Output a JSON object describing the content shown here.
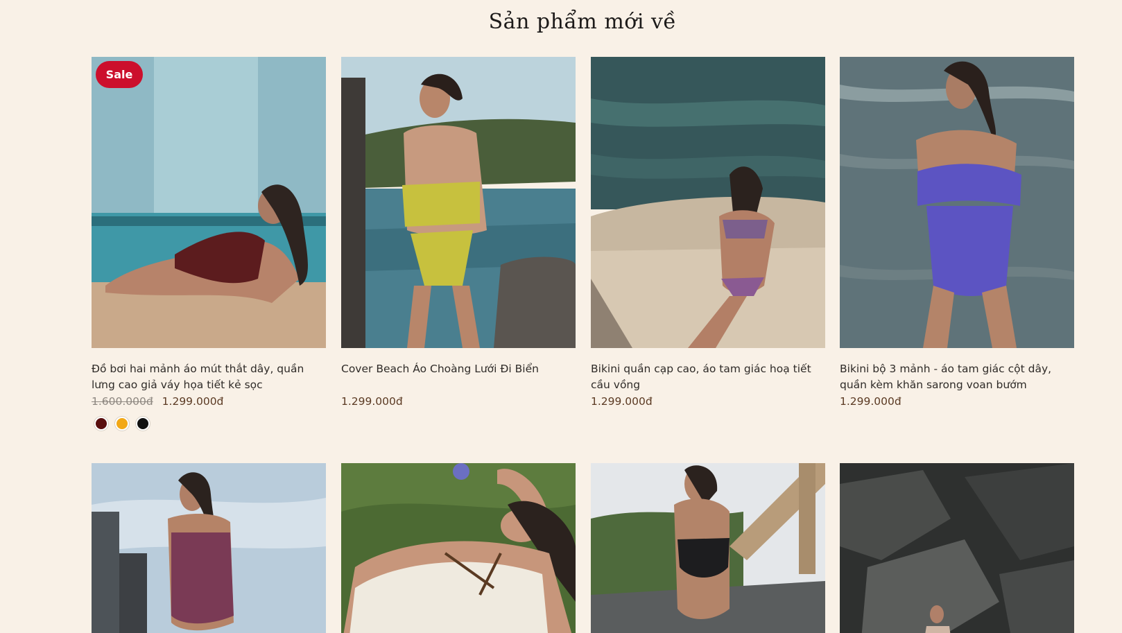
{
  "section": {
    "title": "Sản phẩm mới về"
  },
  "products": [
    {
      "name": "Đồ bơi hai mảnh áo mút thắt dây, quần lưng cao giả váy họa tiết kẻ sọc",
      "badge": "Sale",
      "old_price": "1.600.000đ",
      "price": "1.299.000đ",
      "swatches": [
        "#5a0f0f",
        "#f2a817",
        "#111111"
      ]
    },
    {
      "name": "Cover Beach Áo Choàng Lưới Đi Biển",
      "price": "1.299.000đ"
    },
    {
      "name": "Bikini quần cạp cao, áo tam giác hoạ tiết cầu vồng",
      "price": "1.299.000đ"
    },
    {
      "name": "Bikini bộ 3 mảnh - áo tam giác cột dây, quần kèm khăn sarong voan bướm",
      "price": "1.299.000đ"
    }
  ],
  "colors": {
    "background": "#f9f1e7",
    "sale_badge": "#cc0f2c",
    "price_text": "#5b3a23"
  }
}
